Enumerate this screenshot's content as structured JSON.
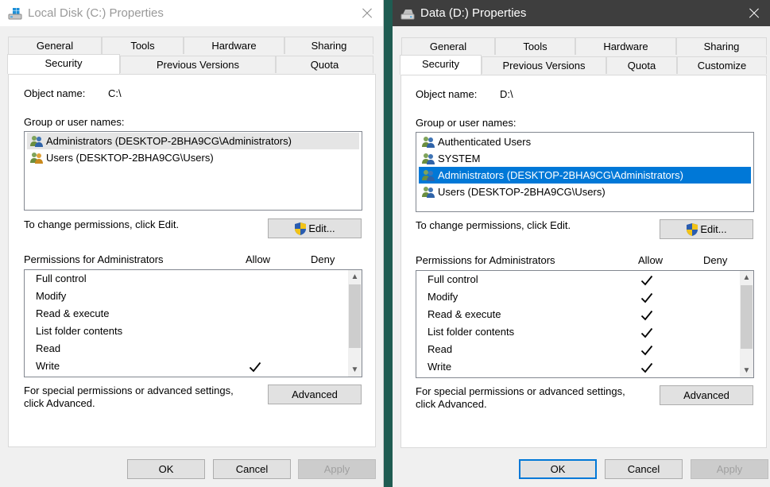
{
  "windows": [
    {
      "title": "Local Disk (C:) Properties",
      "tabs_row1": [
        "General",
        "Tools",
        "Hardware",
        "Sharing"
      ],
      "tabs_row2": [
        "Security",
        "Previous Versions",
        "Quota"
      ],
      "active_tab": "Security",
      "object_label": "Object name:",
      "object_value": "C:\\",
      "group_label": "Group or user names:",
      "users": [
        "Administrators (DESKTOP-2BHA9CG\\Administrators)",
        "Users (DESKTOP-2BHA9CG\\Users)"
      ],
      "selected_user_index": 0,
      "change_text": "To change permissions, click Edit.",
      "edit_label": "Edit...",
      "permissions_label": "Permissions for Administrators",
      "allow_label": "Allow",
      "deny_label": "Deny",
      "permissions": [
        {
          "name": "Full control",
          "allow": false,
          "deny": false
        },
        {
          "name": "Modify",
          "allow": false,
          "deny": false
        },
        {
          "name": "Read & execute",
          "allow": false,
          "deny": false
        },
        {
          "name": "List folder contents",
          "allow": false,
          "deny": false
        },
        {
          "name": "Read",
          "allow": false,
          "deny": false
        },
        {
          "name": "Write",
          "allow": true,
          "deny": false
        }
      ],
      "special_text_1": "For special permissions or advanced settings,",
      "special_text_2": "click Advanced.",
      "advanced_label": "Advanced",
      "ok_label": "OK",
      "cancel_label": "Cancel",
      "apply_label": "Apply"
    },
    {
      "title": "Data (D:) Properties",
      "tabs_row1": [
        "General",
        "Tools",
        "Hardware",
        "Sharing"
      ],
      "tabs_row2": [
        "Security",
        "Previous Versions",
        "Quota",
        "Customize"
      ],
      "active_tab": "Security",
      "object_label": "Object name:",
      "object_value": "D:\\",
      "group_label": "Group or user names:",
      "users": [
        "Authenticated Users",
        "SYSTEM",
        "Administrators (DESKTOP-2BHA9CG\\Administrators)",
        "Users (DESKTOP-2BHA9CG\\Users)"
      ],
      "selected_user_index": 2,
      "change_text": "To change permissions, click Edit.",
      "edit_label": "Edit...",
      "permissions_label": "Permissions for Administrators",
      "allow_label": "Allow",
      "deny_label": "Deny",
      "permissions": [
        {
          "name": "Full control",
          "allow": true,
          "deny": false
        },
        {
          "name": "Modify",
          "allow": true,
          "deny": false
        },
        {
          "name": "Read & execute",
          "allow": true,
          "deny": false
        },
        {
          "name": "List folder contents",
          "allow": true,
          "deny": false
        },
        {
          "name": "Read",
          "allow": true,
          "deny": false
        },
        {
          "name": "Write",
          "allow": true,
          "deny": false
        }
      ],
      "special_text_1": "For special permissions or advanced settings,",
      "special_text_2": "click Advanced.",
      "advanced_label": "Advanced",
      "ok_label": "OK",
      "cancel_label": "Cancel",
      "apply_label": "Apply"
    }
  ],
  "icons": {
    "drive_c": "windows-drive-icon",
    "drive_d": "drive-icon",
    "user": "user-group-icon",
    "shield": "uac-shield-icon",
    "check": "checkmark-icon",
    "close": "close-icon"
  },
  "colors": {
    "selection_blue": "#0078d7",
    "selection_grey": "#e5e5e5",
    "dark_titlebar": "#3e3e3e",
    "desktop": "#1f5c52"
  }
}
